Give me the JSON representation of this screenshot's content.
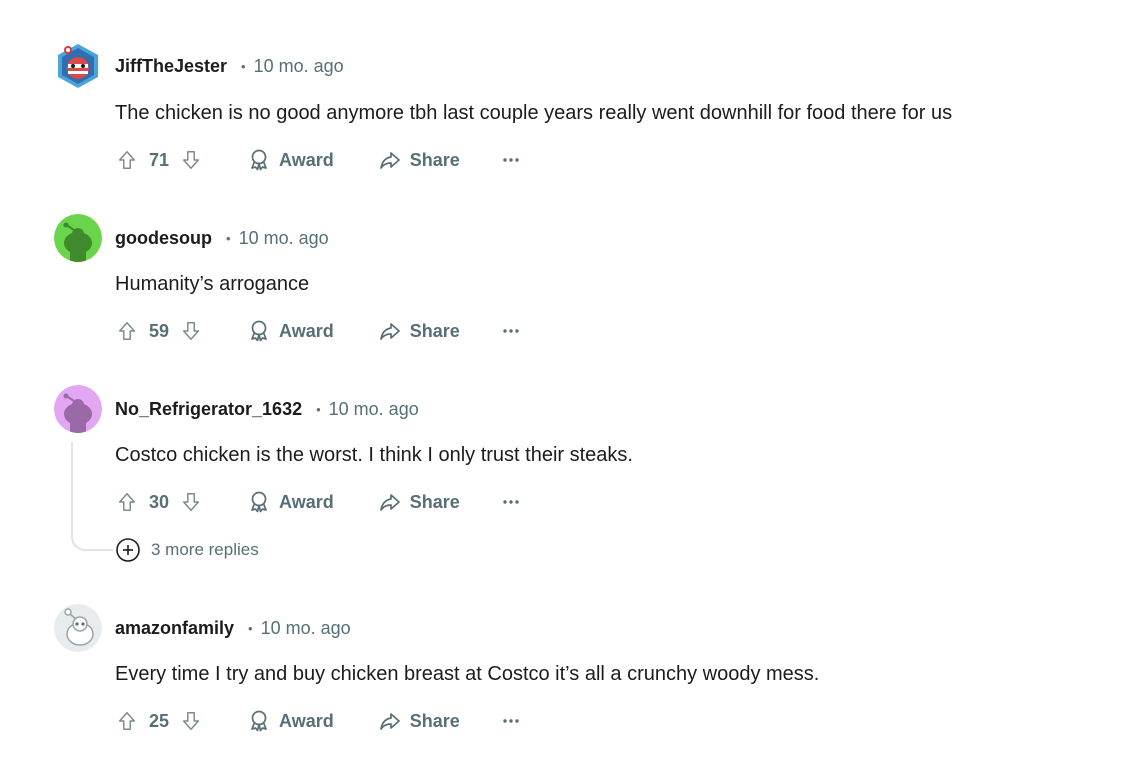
{
  "comments": [
    {
      "username": "JiffTheJester",
      "dot": "•",
      "time": "10 mo. ago",
      "text": "The chicken is no good anymore tbh last couple years really went downhill for food there for us",
      "score": "71",
      "award_label": "Award",
      "share_label": "Share",
      "avatar_color": "#4aa3d9"
    },
    {
      "username": "goodesoup",
      "dot": "•",
      "time": "10 mo. ago",
      "text": "Humanity’s arrogance",
      "score": "59",
      "award_label": "Award",
      "share_label": "Share",
      "avatar_color": "#6ad44a"
    },
    {
      "username": "No_Refrigerator_1632",
      "dot": "•",
      "time": "10 mo. ago",
      "text": "Costco chicken is the worst.  I think I only trust their steaks.",
      "score": "30",
      "award_label": "Award",
      "share_label": "Share",
      "avatar_color": "#e3a6f2"
    },
    {
      "username": "amazonfamily",
      "dot": "•",
      "time": "10 mo. ago",
      "text": "Every time I try and buy chicken breast at Costco it’s all a crunchy woody mess.",
      "score": "25",
      "award_label": "Award",
      "share_label": "Share",
      "avatar_color": "#e8ecee"
    }
  ],
  "more_replies": {
    "label": "3 more replies"
  },
  "icons": {
    "upvote": "upvote-icon",
    "downvote": "downvote-icon",
    "award": "award-icon",
    "share": "share-icon",
    "more": "more-icon",
    "expand": "expand-replies-icon"
  },
  "colors": {
    "meta": "#576f76",
    "text": "#1c1c1c",
    "thread": "#dfe3e5"
  }
}
